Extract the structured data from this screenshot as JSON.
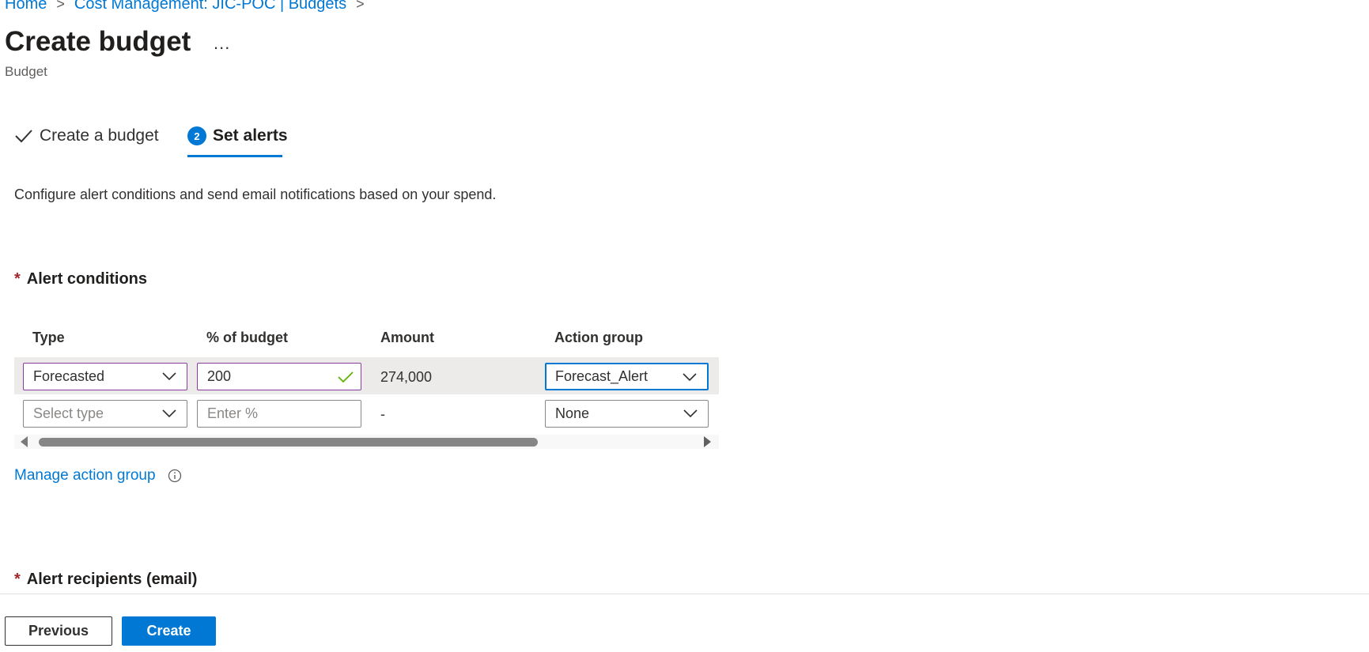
{
  "breadcrumb": {
    "items": [
      "Home",
      "Cost Management: JIC-POC | Budgets"
    ],
    "separator": ">"
  },
  "header": {
    "title": "Create budget",
    "more": "...",
    "subtitle": "Budget"
  },
  "tabs": [
    {
      "label": "Create a budget",
      "state": "completed",
      "icon": "check-icon"
    },
    {
      "label": "Set alerts",
      "state": "active",
      "step": "2"
    }
  ],
  "description": "Configure alert conditions and send email notifications based on your spend.",
  "alert_conditions": {
    "required_mark": "*",
    "title": "Alert conditions",
    "columns": [
      "Type",
      "% of budget",
      "Amount",
      "Action group"
    ],
    "rows": [
      {
        "type": "Forecasted",
        "percent": "200",
        "amount": "274,000",
        "action_group": "Forecast_Alert"
      },
      {
        "type_placeholder": "Select type",
        "percent_placeholder": "Enter %",
        "amount": "-",
        "action_group": "None"
      }
    ]
  },
  "manage_action_group": "Manage action group",
  "alert_recipients": {
    "required_mark": "*",
    "title": "Alert recipients (email)"
  },
  "footer": {
    "previous": "Previous",
    "create": "Create"
  },
  "colors": {
    "accent": "#0078d4",
    "required": "#a4262c",
    "valid_check": "#107c10"
  }
}
